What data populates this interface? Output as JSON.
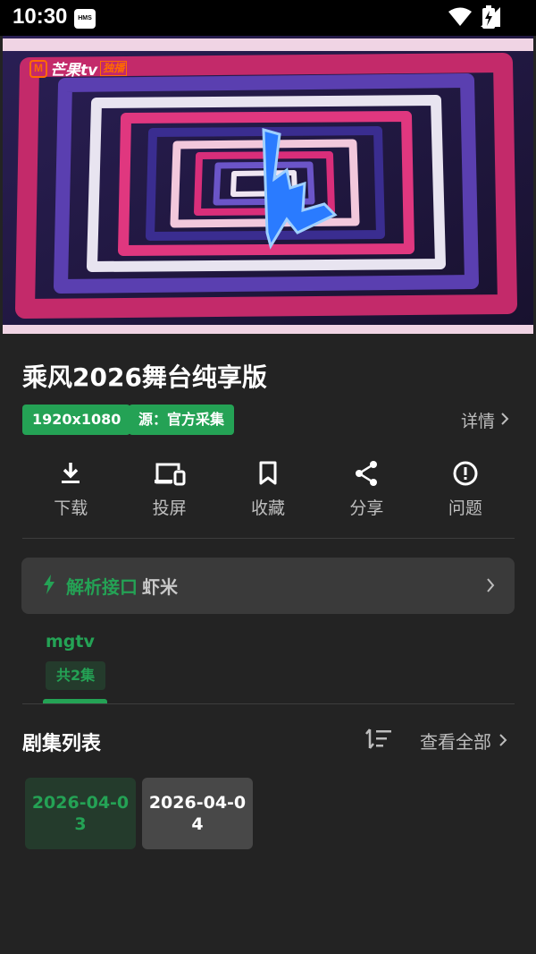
{
  "status_bar": {
    "time": "10:30",
    "badge": "HMS"
  },
  "video": {
    "logo_text": "芒果tv",
    "logo_tag": "独播"
  },
  "show": {
    "title": "乘风2026舞台纯享版",
    "resolution": "1920x1080",
    "source": "源：官方采集",
    "details_label": "详情"
  },
  "actions": [
    {
      "label": "下载",
      "icon": "download-icon"
    },
    {
      "label": "投屏",
      "icon": "cast-icon"
    },
    {
      "label": "收藏",
      "icon": "bookmark-icon"
    },
    {
      "label": "分享",
      "icon": "share-icon"
    },
    {
      "label": "问题",
      "icon": "alert-icon"
    }
  ],
  "parse": {
    "label": "解析接口",
    "value": "虾米"
  },
  "source_tab": {
    "name": "mgtv",
    "count": "共2集"
  },
  "episodes": {
    "title": "剧集列表",
    "view_all": "查看全部",
    "items": [
      {
        "line1": "2026-04-0",
        "line2": "3",
        "selected": true
      },
      {
        "line1": "2026-04-0",
        "line2": "4",
        "selected": false
      }
    ]
  },
  "colors": {
    "accent": "#24a255",
    "background": "#232323",
    "card": "#3a3a3a"
  }
}
